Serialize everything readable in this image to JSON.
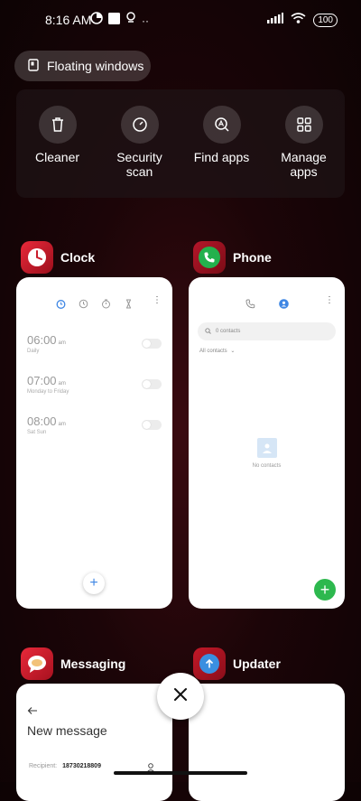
{
  "status_bar": {
    "time": "8:16 AM",
    "battery": "100",
    "icons": [
      "data-saver-icon",
      "square-notification-icon",
      "location-icon",
      "more-dots-icon",
      "signal-icon",
      "wifi-icon",
      "battery-icon"
    ]
  },
  "floating_windows": {
    "label": "Floating windows",
    "icon": "floating-window-icon"
  },
  "quick_actions": [
    {
      "label": "Cleaner",
      "icon": "trash-icon"
    },
    {
      "label": "Security\nscan",
      "icon": "shield-check-icon"
    },
    {
      "label": "Find apps",
      "icon": "find-apps-icon"
    },
    {
      "label": "Manage\napps",
      "icon": "grid-icon"
    }
  ],
  "apps": {
    "clock": {
      "name": "Clock",
      "icon_color": "#c91b2a",
      "alarms": [
        {
          "time": "06:00",
          "ampm": "am",
          "repeat": "Daily"
        },
        {
          "time": "07:00",
          "ampm": "am",
          "repeat": "Monday to Friday"
        },
        {
          "time": "08:00",
          "ampm": "am",
          "repeat": "Sat Sun"
        }
      ],
      "add_label": "+"
    },
    "phone": {
      "name": "Phone",
      "icon_color": "#23b14d",
      "search_placeholder": "0 contacts",
      "all_contacts": "All contacts",
      "no_contacts": "No contacts",
      "add_label": "+"
    },
    "messaging": {
      "name": "Messaging",
      "icon_color": "#d6202e",
      "title": "New message",
      "recipient_label": "Recipient:",
      "recipient_value": "18730218809",
      "back_icon": "back-arrow-icon"
    },
    "updater": {
      "name": "Updater",
      "icon_color": "#3a8fe0"
    }
  },
  "close_button": {
    "label": "×"
  },
  "colors": {
    "accent_blue": "#3e86e4",
    "accent_green": "#2db84e"
  }
}
